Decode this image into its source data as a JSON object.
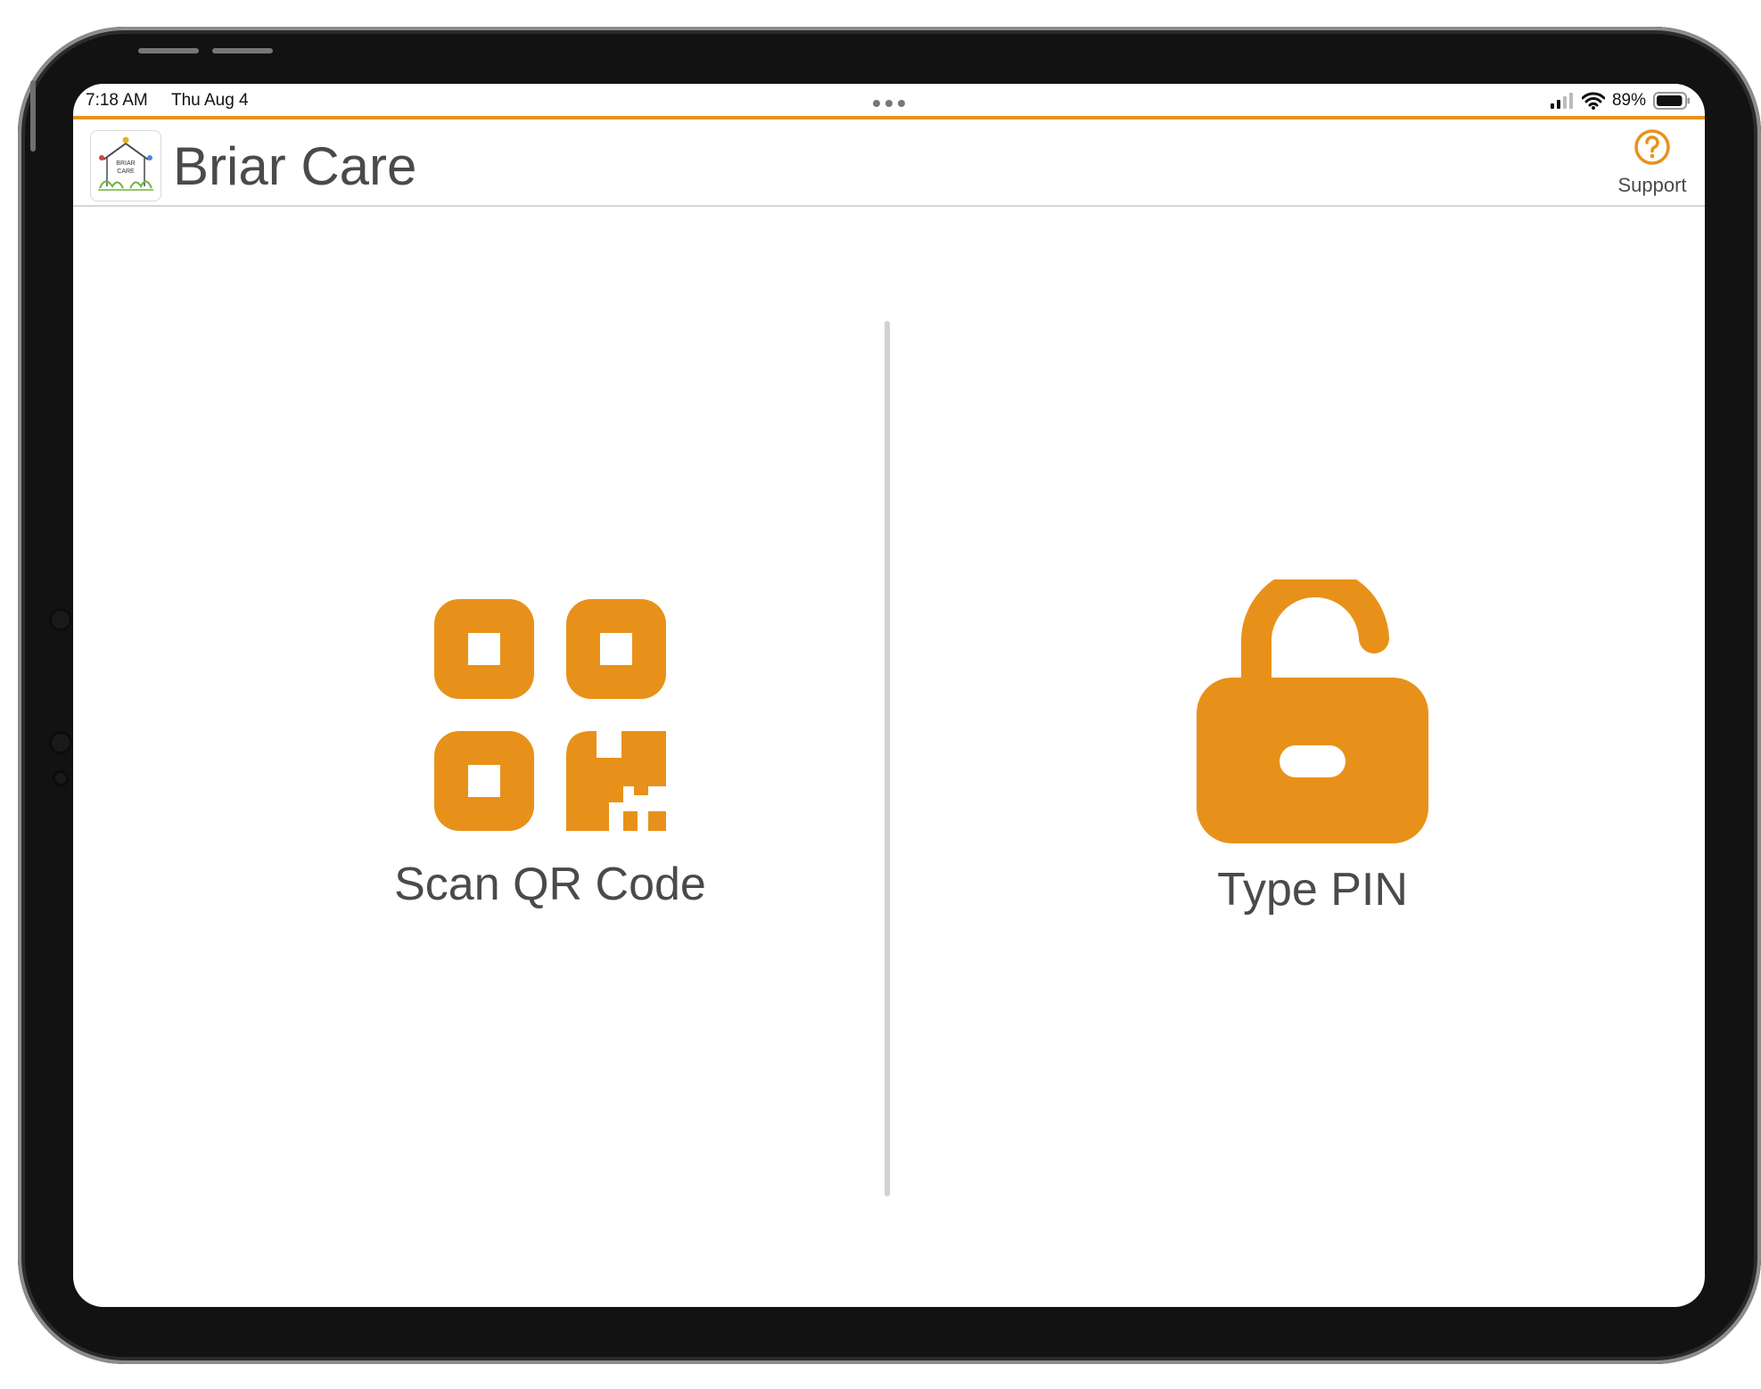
{
  "status_bar": {
    "time": "7:18 AM",
    "date": "Thu Aug 4",
    "battery_percent": "89%",
    "battery_level": 0.89
  },
  "app": {
    "title": "Briar Care",
    "logo_text_line1": "BRIAR",
    "logo_text_line2": "CARE"
  },
  "header": {
    "support_label": "Support"
  },
  "options": {
    "scan_qr_label": "Scan QR Code",
    "type_pin_label": "Type PIN"
  },
  "colors": {
    "accent": "#e8911a",
    "text": "#4a4a4a",
    "divider": "#d2d2d2"
  },
  "icons": [
    "qr-code-icon",
    "unlocked-padlock-icon",
    "question-circle-icon",
    "signal-icon",
    "wifi-icon",
    "battery-icon"
  ]
}
